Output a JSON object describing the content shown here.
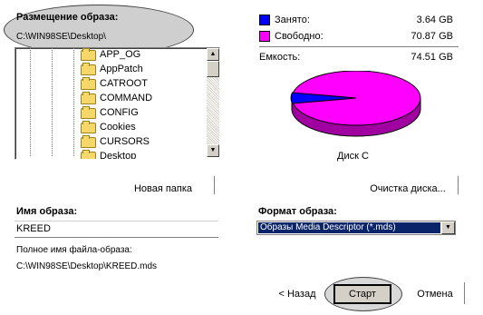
{
  "location": {
    "label": "Размещение образа:",
    "path": "C:\\WIN98SE\\Desktop\\"
  },
  "folders": [
    "APP_OG",
    "AppPatch",
    "CATROOT",
    "COMMAND",
    "CONFIG",
    "Cookies",
    "CURSORS",
    "Desktop"
  ],
  "new_folder_label": "Новая папка",
  "disk_cleanup_label": "Очистка диска...",
  "legend": {
    "used_label": "Занято:",
    "used_value": "3.64 GB",
    "used_color": "#0000ff",
    "free_label": "Свободно:",
    "free_value": "70.87 GB",
    "free_color": "#ff00ff",
    "capacity_label": "Емкость:",
    "capacity_value": "74.51 GB"
  },
  "disk_label": "Диск C",
  "image_name": {
    "label": "Имя образа:",
    "value": "KREED"
  },
  "full_name": {
    "label": "Полное имя файла-образа:",
    "value": "C:\\WIN98SE\\Desktop\\KREED.mds"
  },
  "format": {
    "label": "Формат образа:",
    "selected": "Образы Media Descriptor (*.mds)"
  },
  "buttons": {
    "back": "< Назад",
    "start": "Старт",
    "cancel": "Отмена"
  },
  "icons": {
    "folder": "folder-icon",
    "scroll_up": "scroll-up-arrow-icon",
    "scroll_down": "scroll-down-arrow-icon",
    "dropdown": "dropdown-arrow-icon"
  }
}
